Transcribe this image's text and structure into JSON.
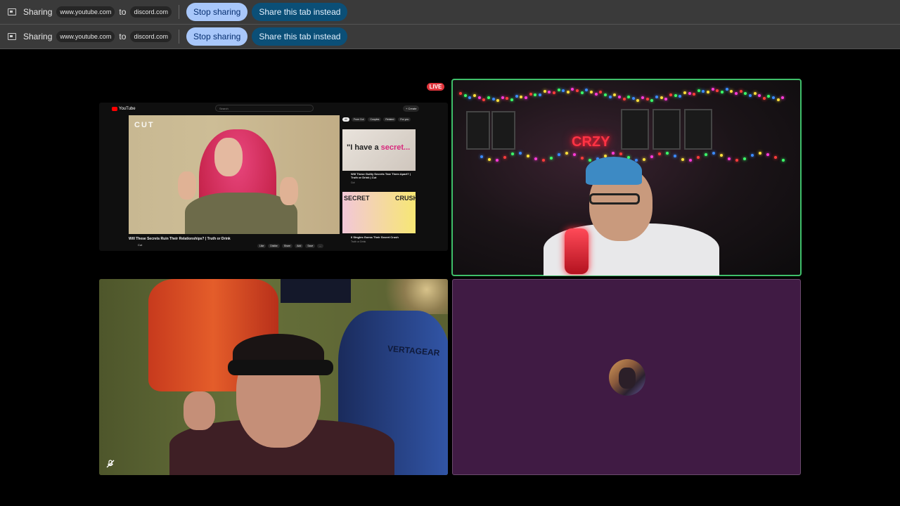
{
  "share_bars": [
    {
      "sharing_label": "Sharing",
      "source": "www.youtube.com",
      "to_label": "to",
      "target": "discord.com",
      "stop_button": "Stop sharing",
      "share_tab_button": "Share this tab instead"
    },
    {
      "sharing_label": "Sharing",
      "source": "www.youtube.com",
      "to_label": "to",
      "target": "discord.com",
      "stop_button": "Stop sharing",
      "share_tab_button": "Share this tab instead"
    }
  ],
  "stream": {
    "live_badge": "LIVE",
    "youtube": {
      "logo": "YouTube",
      "search_placeholder": "Search",
      "create_button": "+ Create",
      "player_brand": "CUT",
      "video_title": "Will These Secrets Ruin Their Relationships? | Truth or Drink",
      "channel": "Cut",
      "actions": [
        "Like",
        "Dislike",
        "Share",
        "Add",
        "Save",
        "..."
      ],
      "chips": [
        "All",
        "From Cut",
        "Couples",
        "Related",
        "For you"
      ],
      "recommended": [
        {
          "thumb_text_1": "\"I have a ",
          "thumb_text_2": "secret...",
          "title": "Will These Guilty Secrets Tear Them Apart? | Truth or Drink | Cut",
          "meta": "Cut"
        },
        {
          "thumb_text_1": "SECRET",
          "thumb_text_2": "CRUSH",
          "title": "6 Singles Guess Their Secret Crush",
          "meta": "Truth or Drink"
        }
      ]
    }
  },
  "webcam_sign": "CRZY",
  "chair_brand": "VERTAGEAR",
  "colors": {
    "speaking_outline": "#3fbf6a",
    "avatar_tile_bg": "#401b44",
    "stop_button_bg": "#a8c7fa",
    "share_button_bg": "#0b4f77"
  },
  "icons": {
    "share_bar": "screen-share-icon",
    "muted": "mic-muted-icon"
  }
}
